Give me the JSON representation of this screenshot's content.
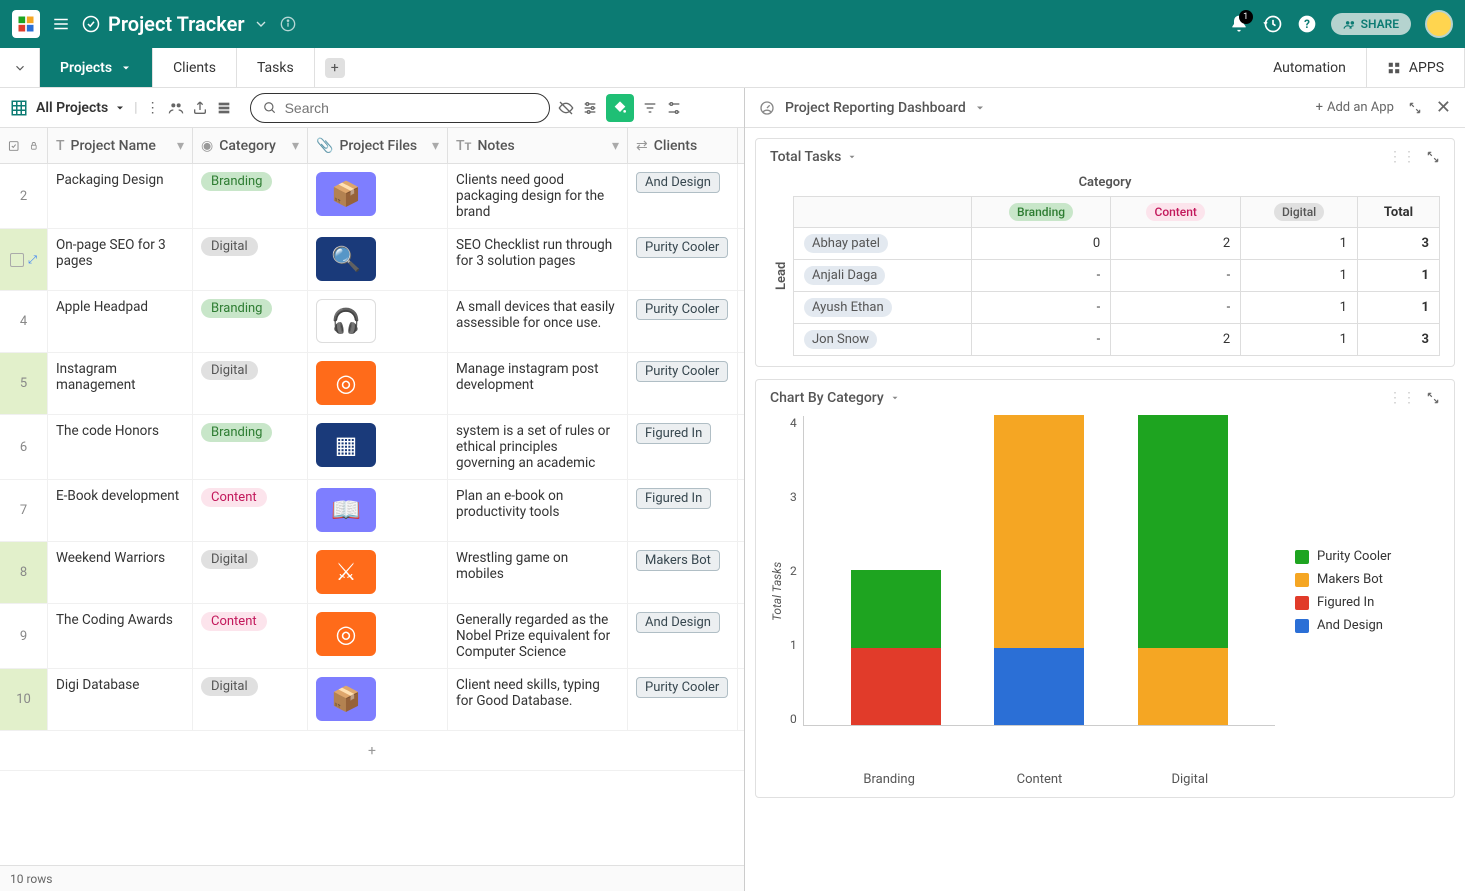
{
  "header": {
    "title": "Project Tracker",
    "notif_count": "1",
    "share_label": "SHARE"
  },
  "tabs": {
    "items": [
      {
        "label": "Projects",
        "active": true,
        "has_chevron": true
      },
      {
        "label": "Clients",
        "active": false
      },
      {
        "label": "Tasks",
        "active": false
      }
    ],
    "automation": "Automation",
    "apps": "APPS"
  },
  "toolbar": {
    "view_name": "All Projects",
    "search_placeholder": "Search"
  },
  "columns": {
    "name": "Project Name",
    "category": "Category",
    "files": "Project Files",
    "notes": "Notes",
    "clients": "Clients"
  },
  "rows": [
    {
      "idx": "2",
      "name": "Packaging Design",
      "cat": "Branding",
      "cat_class": "branding",
      "file_class": "purple",
      "file_glyph": "📦",
      "notes": "Clients need good packaging design for the brand",
      "client": "And Design",
      "hl": false
    },
    {
      "idx": "",
      "name": "On-page SEO for 3 pages",
      "cat": "Digital",
      "cat_class": "digital",
      "file_class": "blue",
      "file_glyph": "🔍",
      "notes": "SEO Checklist run through for 3 solution pages",
      "client": "Purity Cooler",
      "hl": false,
      "sel": true
    },
    {
      "idx": "4",
      "name": "Apple Headpad",
      "cat": "Branding",
      "cat_class": "branding",
      "file_class": "white",
      "file_glyph": "🎧",
      "notes": "A small devices that easily assessible for once use.",
      "client": "Purity Cooler",
      "hl": false
    },
    {
      "idx": "5",
      "name": "Instagram management",
      "cat": "Digital",
      "cat_class": "digital",
      "file_class": "orange",
      "file_glyph": "◎",
      "notes": "Manage instagram post development",
      "client": "Purity Cooler",
      "hl": true
    },
    {
      "idx": "6",
      "name": "The code Honors",
      "cat": "Branding",
      "cat_class": "branding",
      "file_class": "blue",
      "file_glyph": "▦",
      "notes": "system is a set of rules or ethical principles governing an academic",
      "client": "Figured In",
      "hl": false
    },
    {
      "idx": "7",
      "name": "E-Book development",
      "cat": "Content",
      "cat_class": "content",
      "file_class": "purple",
      "file_glyph": "📖",
      "notes": "Plan an e-book on productivity tools",
      "client": "Figured In",
      "hl": false
    },
    {
      "idx": "8",
      "name": "Weekend Warriors",
      "cat": "Digital",
      "cat_class": "digital",
      "file_class": "orange",
      "file_glyph": "⚔",
      "notes": "Wrestling game on mobiles",
      "client": "Makers Bot",
      "hl": true
    },
    {
      "idx": "9",
      "name": "The Coding Awards",
      "cat": "Content",
      "cat_class": "content",
      "file_class": "orange",
      "file_glyph": "◎",
      "notes": "Generally regarded as the Nobel Prize equivalent for Computer Science",
      "client": "And Design",
      "hl": false
    },
    {
      "idx": "10",
      "name": "Digi Database",
      "cat": "Digital",
      "cat_class": "digital",
      "file_class": "purple",
      "file_glyph": "📦",
      "notes": "Client need skills, typing for Good Database.",
      "client": "Purity Cooler",
      "hl": true
    }
  ],
  "footer": {
    "row_count": "10 rows"
  },
  "dashboard": {
    "title": "Project Reporting Dashboard",
    "add_app": "Add an App",
    "widgets": {
      "pivot": {
        "title": "Total Tasks",
        "hlabel": "Category",
        "vlabel": "Lead",
        "cols": [
          "Branding",
          "Content",
          "Digital",
          "Total"
        ],
        "col_class": [
          "branding",
          "content",
          "digital",
          ""
        ],
        "rows": [
          {
            "lead": "Abhay patel",
            "vals": [
              "0",
              "2",
              "1",
              "3"
            ]
          },
          {
            "lead": "Anjali Daga",
            "vals": [
              "-",
              "-",
              "1",
              "1"
            ]
          },
          {
            "lead": "Ayush Ethan",
            "vals": [
              "-",
              "-",
              "1",
              "1"
            ]
          },
          {
            "lead": "Jon Snow",
            "vals": [
              "-",
              "2",
              "1",
              "3"
            ]
          }
        ]
      },
      "chart": {
        "title": "Chart By Category"
      }
    }
  },
  "chart_data": {
    "type": "bar",
    "stacked": true,
    "categories": [
      "Branding",
      "Content",
      "Digital"
    ],
    "ylabel": "Total Tasks",
    "ylim": [
      0,
      4
    ],
    "yticks": [
      0,
      1,
      2,
      3,
      4
    ],
    "series": [
      {
        "name": "Purity Cooler",
        "color": "#1ea420",
        "values": [
          1,
          0,
          3
        ]
      },
      {
        "name": "Makers Bot",
        "color": "#f5a623",
        "values": [
          0,
          3,
          1
        ]
      },
      {
        "name": "Figured In",
        "color": "#e13b2a",
        "values": [
          1,
          0,
          0
        ]
      },
      {
        "name": "And Design",
        "color": "#2b6fd6",
        "values": [
          0,
          1,
          0
        ]
      }
    ],
    "legend_order": [
      "Purity Cooler",
      "Makers Bot",
      "Figured In",
      "And Design"
    ]
  }
}
